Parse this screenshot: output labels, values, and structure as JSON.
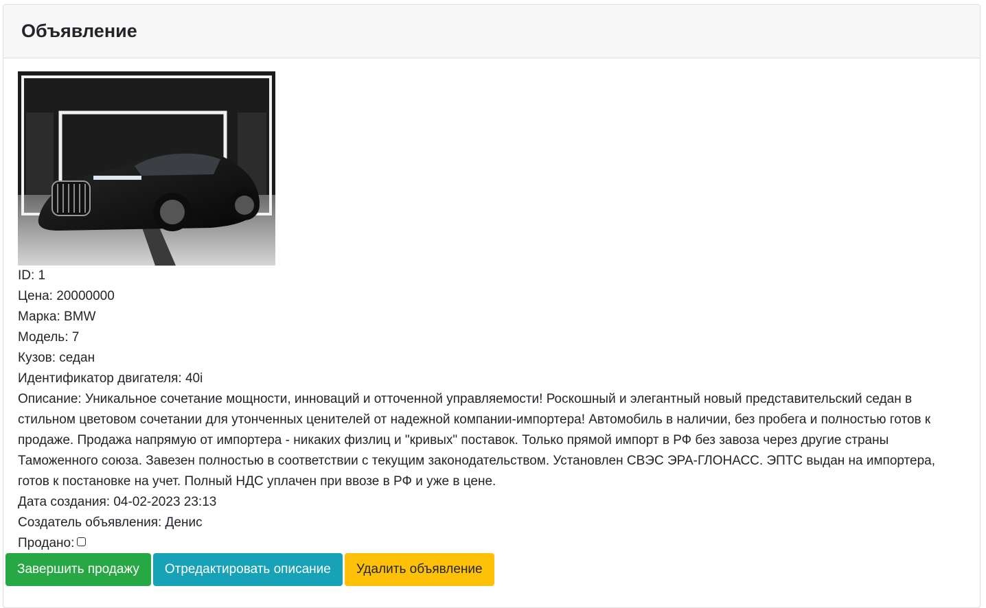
{
  "header": {
    "title": "Объявление"
  },
  "listing": {
    "photo_alt": "BMW 7 sedan photo",
    "id_line": "ID: 1",
    "price_line": "Цена: 20000000",
    "brand_line": "Марка: BMW",
    "model_line": "Модель: 7",
    "body_line": "Кузов: седан",
    "engine_line": "Идентификатор двигателя: 40i",
    "description_line": "Описание: Уникальное сочетание мощности, инноваций и отточенной управляемости! Роскошный и элегантный новый представительский седан в стильном цветовом сочетании для утонченных ценителей от надежной компании-импортера! Автомобиль в наличии, без пробега и полностью готов к продаже. Продажа напрямую от импортера - никаких физлиц и \"кривых\" поставок. Только прямой импорт в РФ без завоза через другие страны Таможенного союза. Завезен полностью в соответствии с текущим законодательством. Установлен СВЭС ЭРА-ГЛОНАСС. ЭПТС выдан на импортера, готов к постановке на учет. Полный НДС уплачен при ввозе в РФ и уже в цене.",
    "created_line": "Дата создания: 04-02-2023 23:13",
    "creator_line": "Создатель объявления: Денис",
    "sold_label": "Продано:",
    "sold": false
  },
  "actions": {
    "complete_sale_label": "Завершить продажу",
    "edit_description_label": "Отредактировать описание",
    "delete_listing_label": "Удалить объявление"
  },
  "colors": {
    "success": "#28a745",
    "info": "#17a2b8",
    "warning": "#ffc107"
  }
}
